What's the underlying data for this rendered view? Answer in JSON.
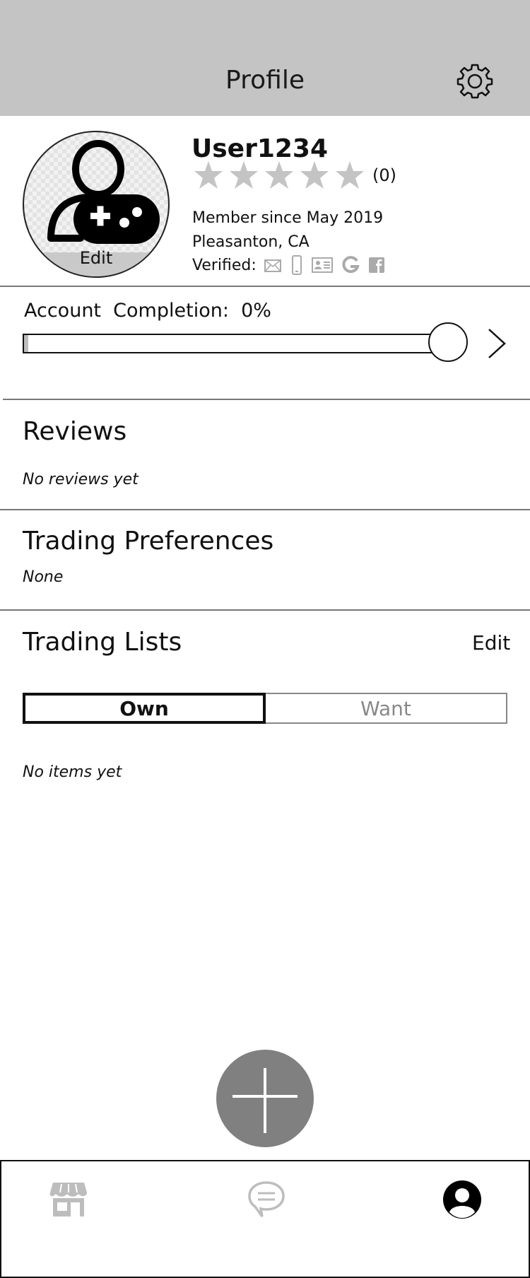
{
  "header": {
    "title": "Profile",
    "settings_icon": "gear-icon"
  },
  "profile": {
    "avatar_icon": "gamer-avatar-icon",
    "avatar_edit_label": "Edit",
    "username": "User1234",
    "rating_stars": 5,
    "rating_count": "(0)",
    "member_since": "Member since May 2019",
    "location": "Pleasanton, CA",
    "verified_label": "Verified:",
    "verified_icons": [
      "email-icon",
      "phone-icon",
      "id-card-icon",
      "google-icon",
      "facebook-icon"
    ]
  },
  "completion": {
    "label": "Account  Completion:  0%",
    "value": 0.01
  },
  "reviews": {
    "title": "Reviews",
    "empty": "No reviews yet"
  },
  "preferences": {
    "title": "Trading Preferences",
    "value": "None"
  },
  "lists": {
    "title": "Trading Lists",
    "edit_label": "Edit",
    "tabs": [
      "Own",
      "Want"
    ],
    "active_tab": "Own",
    "empty": "No items yet"
  },
  "fab": {
    "icon": "plus-icon"
  },
  "tabbar": {
    "items": [
      "store-icon",
      "chat-icon",
      "profile-icon"
    ],
    "active": "profile-icon"
  },
  "colors": {
    "header_bg": "#c4c4c4",
    "fab_bg": "#808080",
    "inactive_icon": "#bdbdbd"
  }
}
